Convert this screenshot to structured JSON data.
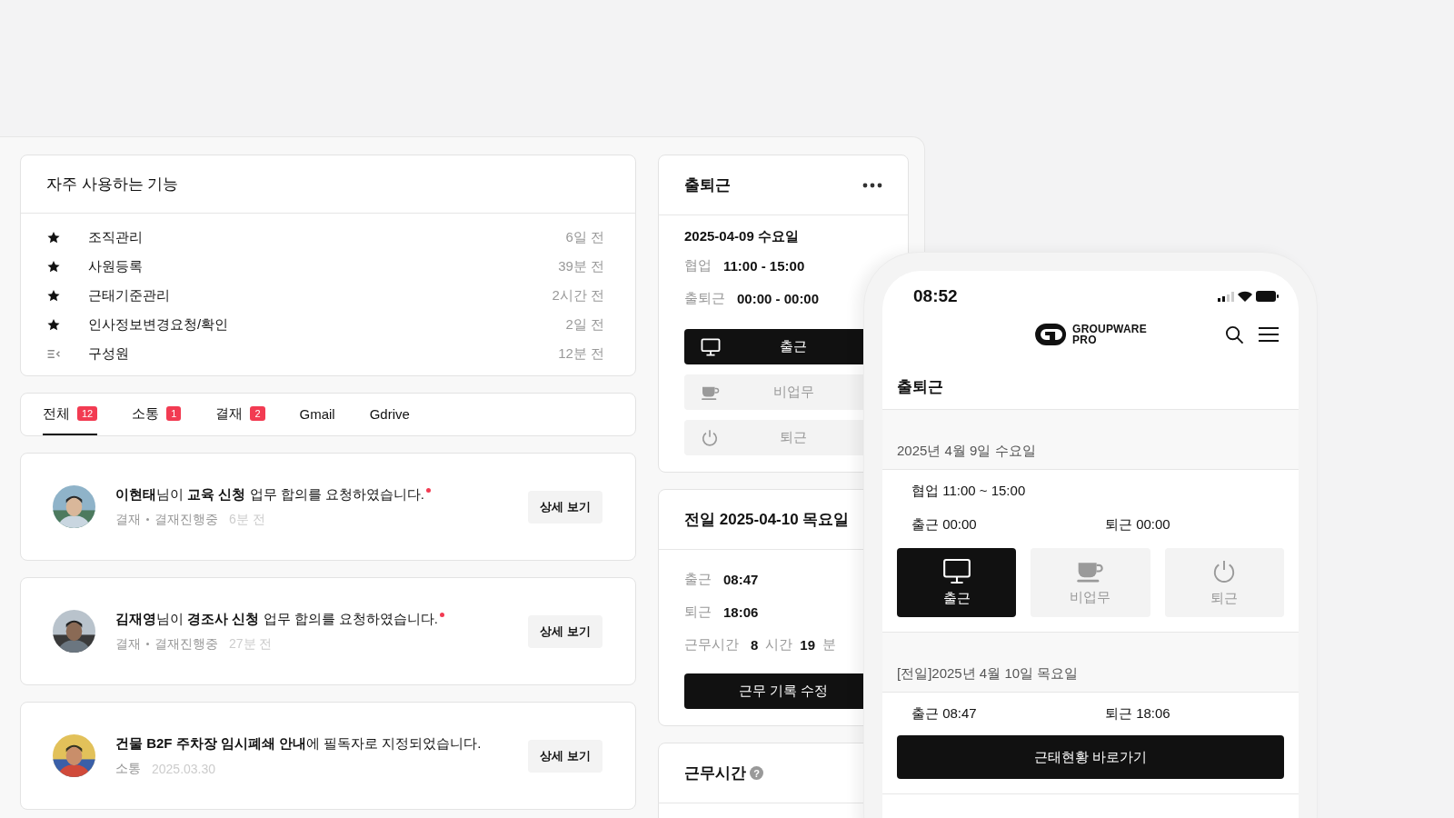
{
  "favorites": {
    "title": "자주 사용하는 기능",
    "items": [
      {
        "kind": "star",
        "label": "조직관리",
        "time": "6일 전"
      },
      {
        "kind": "star",
        "label": "사원등록",
        "time": "39분 전"
      },
      {
        "kind": "star",
        "label": "근태기준관리",
        "time": "2시간 전"
      },
      {
        "kind": "star",
        "label": "인사정보변경요청/확인",
        "time": "2일 전"
      },
      {
        "kind": "list",
        "label": "구성원",
        "time": "12분 전"
      }
    ]
  },
  "tabs": [
    {
      "label": "전체",
      "count": "12",
      "selected": true
    },
    {
      "label": "소통",
      "count": "1",
      "selected": false
    },
    {
      "label": "결재",
      "count": "2",
      "selected": false
    },
    {
      "label": "Gmail",
      "selected": false
    },
    {
      "label": "Gdrive",
      "selected": false
    }
  ],
  "notifications": [
    {
      "message": "**이현태**님이 **교육 신청** 업무 합의를 요청하였습니다.",
      "unread": true,
      "category": "결재",
      "status": "결재진행중",
      "time": "6분 전",
      "button": "상세 보기"
    },
    {
      "message": "**김재영**님이 **경조사 신청** 업무 합의를 요청하였습니다.",
      "unread": true,
      "category": "결재",
      "status": "결재진행중",
      "time": "27분 전",
      "button": "상세 보기"
    },
    {
      "message": "**건물 B2F 주차장 임시폐쇄 안내**에 필독자로 지정되었습니다.",
      "unread": false,
      "category": "소통",
      "time": "2025.03.30",
      "button": "상세 보기"
    }
  ],
  "attendance": {
    "title": "출퇴근",
    "date": "2025-04-09 수요일",
    "rows": [
      {
        "label": "협업",
        "value": "11:00 - 15:00"
      },
      {
        "label": "출퇴근",
        "value": "00:00 - 00:00"
      }
    ],
    "buttons": [
      {
        "kind": "monitor",
        "label": "출근",
        "disabled": false
      },
      {
        "kind": "cup",
        "label": "비업무",
        "disabled": true
      },
      {
        "kind": "power",
        "label": "퇴근",
        "disabled": true
      }
    ]
  },
  "previous_day": {
    "title": "전일 2025-04-10 목요일",
    "rows": [
      {
        "label": "출근",
        "value": "08:47"
      },
      {
        "label": "퇴근",
        "value": "18:06"
      }
    ],
    "work_hours": {
      "label": "근무시간",
      "hours": "8",
      "hours_unit": "시간",
      "minutes": "19",
      "minutes_unit": "분"
    },
    "button": "근무 기록 수정"
  },
  "work_time": {
    "title": "근무시간",
    "help": "?"
  },
  "phone": {
    "time": "08:52",
    "logo": {
      "line1": "GROUPWARE",
      "line2": "PRO"
    },
    "title": "출퇴근",
    "today": {
      "date": "2025년 4월 9일 수요일",
      "schedule": "협업 11:00 ~ 15:00",
      "clock_in": "출근 00:00",
      "clock_out": "퇴근 00:00",
      "buttons": [
        {
          "kind": "monitor",
          "label": "출근",
          "disabled": false
        },
        {
          "kind": "cup",
          "label": "비업무",
          "disabled": true
        },
        {
          "kind": "power",
          "label": "퇴근",
          "disabled": true
        }
      ]
    },
    "previous": {
      "date": "[전일]2025년 4월 10일 목요일",
      "clock_in": "출근 08:47",
      "clock_out": "퇴근 18:06"
    },
    "button": "근태현황 바로가기"
  }
}
